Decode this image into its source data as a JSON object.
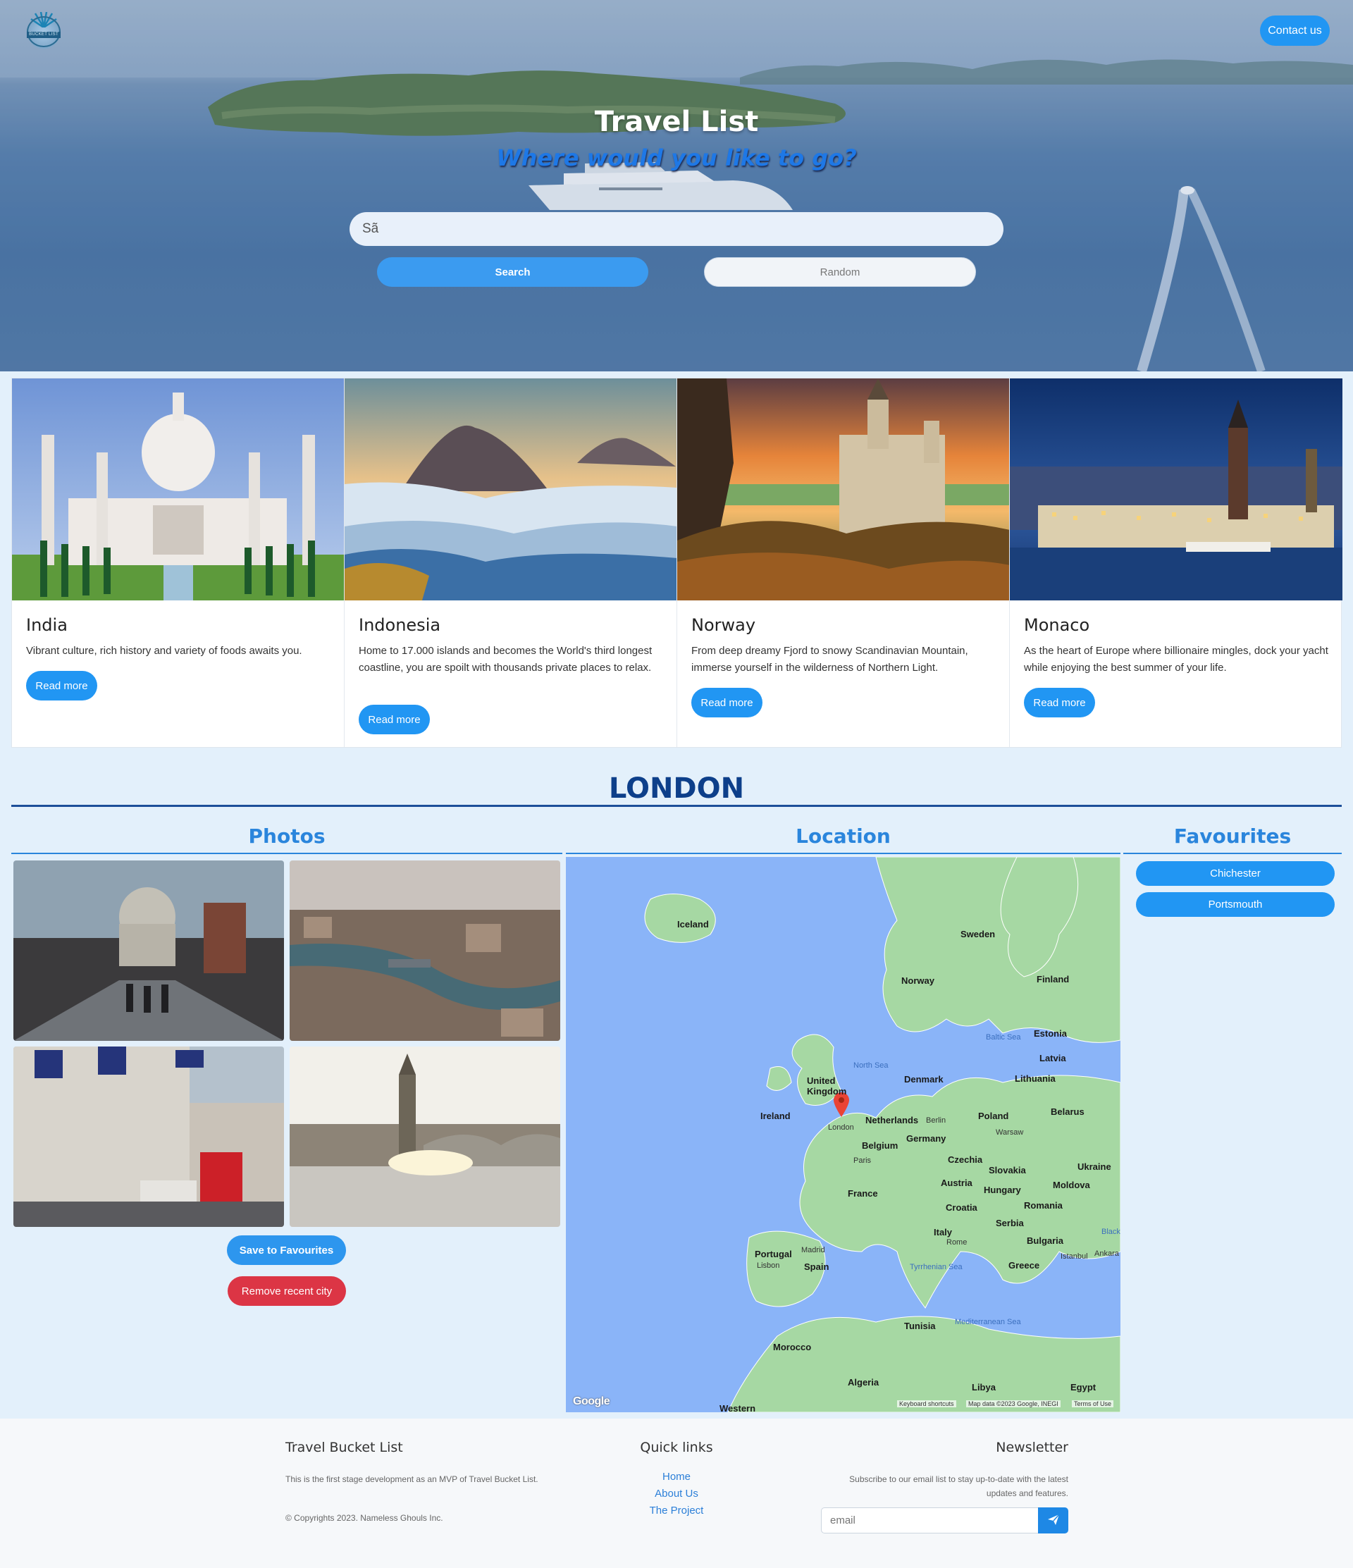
{
  "header": {
    "logo_text": "BUCKET LIST",
    "contact_label": "Contact us"
  },
  "hero": {
    "title": "Travel List",
    "subtitle": "Where would you like to go?",
    "search_value": "Sã",
    "search_label": "Search",
    "random_label": "Random"
  },
  "cards": [
    {
      "title": "India",
      "text": "Vibrant culture, rich history and variety of foods awaits you.",
      "button": "Read more"
    },
    {
      "title": "Indonesia",
      "text": "Home to 17.000 islands and becomes the World's third longest coastline, you are spoilt with thousands private places to relax.",
      "button": "Read more"
    },
    {
      "title": "Norway",
      "text": "From deep dreamy Fjord to snowy Scandinavian Mountain, immerse yourself in the wilderness of Northern Light.",
      "button": "Read more"
    },
    {
      "title": "Monaco",
      "text": "As the heart of Europe where billionaire mingles, dock your yacht while enjoying the best summer of your life.",
      "button": "Read more"
    }
  ],
  "city": {
    "name": "LONDON",
    "photos_heading": "Photos",
    "location_heading": "Location",
    "favourites_heading": "Favourites",
    "save_label": "Save to Favourites",
    "remove_label": "Remove recent city",
    "favourites": [
      "Chichester",
      "Portsmouth"
    ]
  },
  "map": {
    "labels": [
      "Iceland",
      "Sweden",
      "Norway",
      "Finland",
      "Estonia",
      "Latvia",
      "Lithuania",
      "Denmark",
      "United Kingdom",
      "Ireland",
      "London",
      "Netherlands",
      "Berlin",
      "Poland",
      "Warsaw",
      "Belarus",
      "Germany",
      "Belgium",
      "Paris",
      "Czechia",
      "Slovakia",
      "Ukraine",
      "Austria",
      "Hungary",
      "Moldova",
      "France",
      "Romania",
      "Croatia",
      "Serbia",
      "Italy",
      "Rome",
      "Bulgaria",
      "Portugal",
      "Madrid",
      "Spain",
      "Lisbon",
      "Greece",
      "Istanbul",
      "Ankara",
      "Tunisia",
      "Morocco",
      "Algeria",
      "Libya",
      "Egypt",
      "Western"
    ],
    "seas": [
      "North Sea",
      "Baltic Sea",
      "Tyrrhenian Sea",
      "Mediterranean Sea",
      "Black"
    ],
    "attribution": "Google",
    "footer_shortcuts": "Keyboard shortcuts",
    "footer_data": "Map data ©2023 Google, INEGI",
    "footer_terms": "Terms of Use"
  },
  "footer": {
    "about_title": "Travel Bucket List",
    "about_text": "This is the first stage development as an MVP of Travel Bucket List.",
    "copyright": "© Copyrights 2023. Nameless Ghouls Inc.",
    "links_title": "Quick links",
    "links": [
      "Home",
      "About Us",
      "The Project"
    ],
    "newsletter_title": "Newsletter",
    "newsletter_text": "Subscribe to our email list to stay up-to-date with the latest updates and features.",
    "email_placeholder": "email"
  },
  "colors": {
    "primary": "#2196f3",
    "danger": "#dc3545",
    "heading_blue": "#0d3f8a",
    "section_blue": "#2a85dc",
    "page_bg": "#e3f0fb"
  }
}
